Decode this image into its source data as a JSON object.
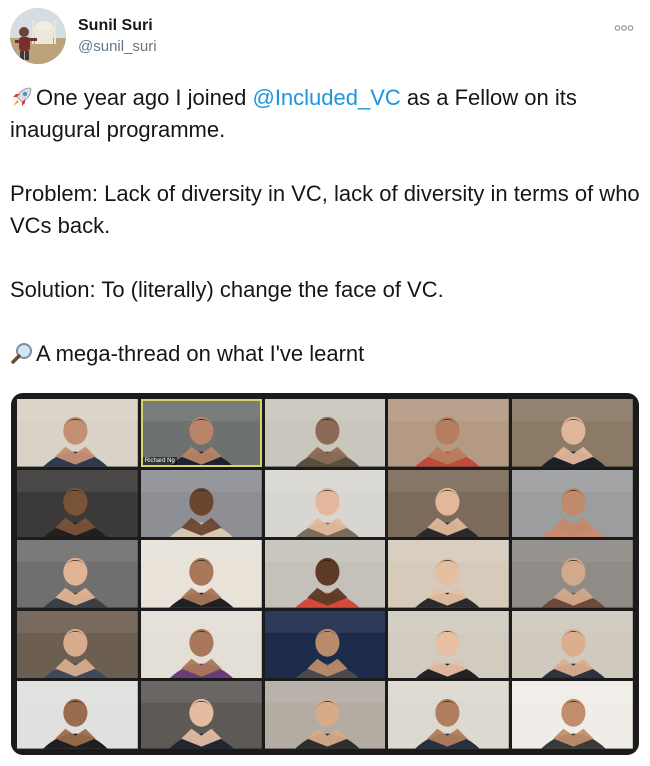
{
  "tweet": {
    "author": {
      "display_name": "Sunil Suri",
      "handle": "@sunil_suri"
    },
    "paragraphs": [
      {
        "emoji": "rocket-icon",
        "before": "One year ago I joined ",
        "mention": "@Included_VC",
        "after": " as a Fellow on its inaugural programme."
      },
      {
        "text": "Problem: Lack of diversity in VC, lack of diversity in terms of who VCs back."
      },
      {
        "text": "Solution: To (literally) change the face of VC."
      },
      {
        "emoji": "magnifying-glass-icon",
        "text": "A mega-thread on what I've learnt"
      }
    ],
    "media": {
      "participant_name_label": "Richard Ng",
      "participants": [
        {
          "bg": "#d9d2c6",
          "skin": "#c58f73",
          "shirt": "#2f3b4c"
        },
        {
          "bg": "#6d7271",
          "skin": "#b98467",
          "shirt": "#1c2230"
        },
        {
          "bg": "#c9c6bd",
          "skin": "#8b6b58",
          "shirt": "#5b4e3e"
        },
        {
          "bg": "#b49a84",
          "skin": "#b57f5f",
          "shirt": "#c14a38"
        },
        {
          "bg": "#8a7a66",
          "skin": "#e0b79b",
          "shirt": "#1a1f2a"
        },
        {
          "bg": "#3c3a38",
          "skin": "#7a5238",
          "shirt": "#202020"
        },
        {
          "bg": "#8d8f94",
          "skin": "#6a4630",
          "shirt": "#d8c8b2"
        },
        {
          "bg": "#d8d6d1",
          "skin": "#e3b89d",
          "shirt": "#7c6c5a"
        },
        {
          "bg": "#7c6b5b",
          "skin": "#e1b89a",
          "shirt": "#2a2a2a"
        },
        {
          "bg": "#9b9d9e",
          "skin": "#c08b6c",
          "shirt": "#c98a6f"
        },
        {
          "bg": "#6f6f6f",
          "skin": "#e1b494",
          "shirt": "#3b3f47"
        },
        {
          "bg": "#e8e2d8",
          "skin": "#a87659",
          "shirt": "#1f2024"
        },
        {
          "bg": "#c5c0ba",
          "skin": "#5c3a26",
          "shirt": "#d44a3a"
        },
        {
          "bg": "#d6cbbb",
          "skin": "#e6bfa3",
          "shirt": "#2b2b2b"
        },
        {
          "bg": "#8f8b86",
          "skin": "#d3a98c",
          "shirt": "#6a4b3c"
        },
        {
          "bg": "#6d5e52",
          "skin": "#d9ac8e",
          "shirt": "#3e4a5c"
        },
        {
          "bg": "#e3ded6",
          "skin": "#a97759",
          "shirt": "#6a3b7a"
        },
        {
          "bg": "#1d2b4a",
          "skin": "#b98a6b",
          "shirt": "#4a4a4a"
        },
        {
          "bg": "#d1cbc0",
          "skin": "#e7c0a4",
          "shirt": "#232323"
        },
        {
          "bg": "#cfc9be",
          "skin": "#dbae8f",
          "shirt": "#2d3140"
        },
        {
          "bg": "#e0e0df",
          "skin": "#9b6b4d",
          "shirt": "#1f1f1f"
        },
        {
          "bg": "#5d5a56",
          "skin": "#e4bca0",
          "shirt": "#202733"
        },
        {
          "bg": "#b3aca3",
          "skin": "#d7aa8a",
          "shirt": "#2e2e2e"
        },
        {
          "bg": "#ddd8d0",
          "skin": "#b07d5e",
          "shirt": "#263140"
        },
        {
          "bg": "#f0ede8",
          "skin": "#c08e6c",
          "shirt": "#3a3a3a"
        }
      ]
    }
  },
  "colors": {
    "text": "#14171a",
    "secondary": "#657786",
    "link": "#1b95e0"
  }
}
